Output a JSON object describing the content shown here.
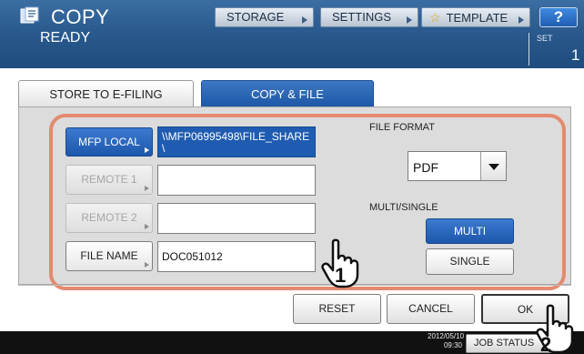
{
  "header": {
    "title": "COPY",
    "status": "READY",
    "buttons": [
      {
        "label": "STORAGE"
      },
      {
        "label": "SETTINGS"
      },
      {
        "label": "TEMPLATE"
      }
    ],
    "help_label": "?",
    "set_label": "SET",
    "set_value": "1"
  },
  "tabs": [
    {
      "label": "STORE TO E-FILING",
      "active": false
    },
    {
      "label": "COPY & FILE",
      "active": true
    }
  ],
  "destinations": [
    {
      "label": "MFP LOCAL",
      "path": "\\\\MFP06995498\\FILE_SHARE\\",
      "state": "active"
    },
    {
      "label": "REMOTE 1",
      "path": "",
      "state": "disabled"
    },
    {
      "label": "REMOTE 2",
      "path": "",
      "state": "disabled"
    }
  ],
  "file_name": {
    "label": "FILE NAME",
    "value": "DOC051012"
  },
  "file_format": {
    "label": "FILE FORMAT",
    "selected": "PDF"
  },
  "multi_single": {
    "label": "MULTI/SINGLE",
    "options": [
      {
        "label": "MULTI",
        "selected": true
      },
      {
        "label": "SINGLE",
        "selected": false
      }
    ]
  },
  "actions": {
    "reset": "RESET",
    "cancel": "CANCEL",
    "ok": "OK"
  },
  "footer": {
    "date": "2012/05/10",
    "time": "09:30",
    "job_status": "JOB STATUS"
  },
  "callouts": [
    "1",
    "2"
  ],
  "colors": {
    "accent_blue": "#1f5cb1",
    "highlight": "#e48a6f",
    "header_blue": "#2a5a8e"
  }
}
